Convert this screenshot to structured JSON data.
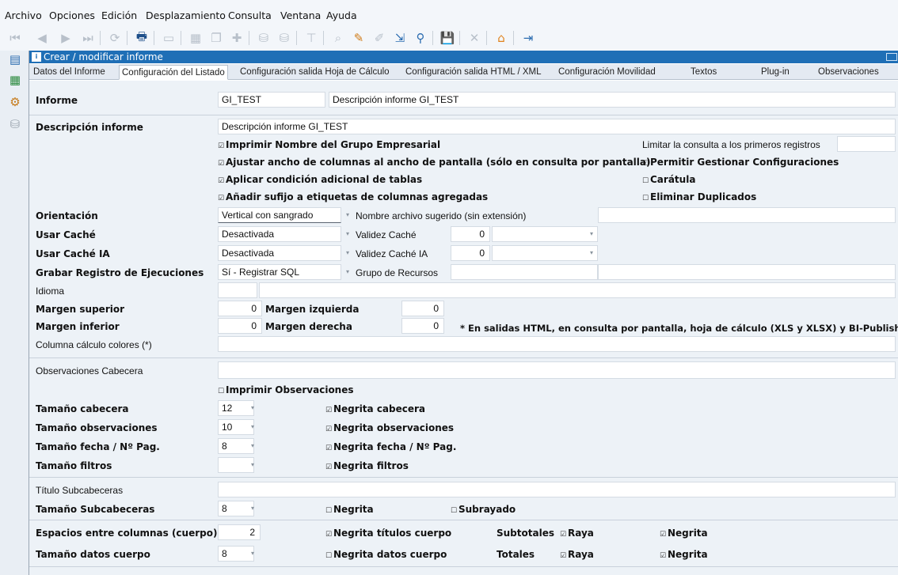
{
  "menu": [
    "Archivo",
    "Opciones",
    "Edición",
    "Desplazamiento",
    "Consulta",
    "Ventana",
    "Ayuda"
  ],
  "window": {
    "title": "Crear / modificar informe"
  },
  "tabs": [
    "Datos del Informe",
    "Configuración del Listado",
    "Configuración salida Hoja de Cálculo",
    "Configuración salida HTML / XML",
    "Configuración Movilidad",
    "Textos",
    "Plug-in",
    "Observaciones"
  ],
  "active_tab": "Configuración del Listado",
  "informe": {
    "label": "Informe",
    "code": "GI_TEST",
    "desc": "Descripción informe GI_TEST"
  },
  "descripcion": {
    "label": "Descripción informe",
    "value": "Descripción informe GI_TEST"
  },
  "checks": {
    "imprimir_nombre": "Imprimir Nombre del Grupo Empresarial",
    "ajustar": "Ajustar ancho de columnas al ancho de pantalla (sólo en consulta por pantalla)",
    "aplicar": "Aplicar condición adicional de tablas",
    "anadir": "Añadir sufijo a etiquetas de columnas agregadas",
    "permitir": "Permitir Gestionar Configuraciones",
    "caratula": "Carátula",
    "eliminar": "Eliminar Duplicados"
  },
  "limitar_label": "Limitar la consulta a los primeros registros",
  "orientacion": {
    "label": "Orientación",
    "value": "Vertical con sangrado",
    "archivo_label": "Nombre archivo sugerido (sin extensión)"
  },
  "cache": {
    "label": "Usar Caché",
    "value": "Desactivada",
    "validez_label": "Validez Caché",
    "validez": "0"
  },
  "cache_ia": {
    "label": "Usar Caché IA",
    "value": "Desactivada",
    "validez_label": "Validez Caché IA",
    "validez": "0"
  },
  "grabar": {
    "label": "Grabar Registro de Ejecuciones",
    "value": "Sí - Registrar SQL",
    "recursos_label": "Grupo de Recursos"
  },
  "idioma_label": "Idioma",
  "margenes": {
    "sup_label": "Margen superior",
    "sup": "0",
    "izq_label": "Margen izquierda",
    "izq": "0",
    "inf_label": "Margen inferior",
    "inf": "0",
    "der_label": "Margen derecha",
    "der": "0",
    "nota": "* En salidas HTML, en consulta por pantalla, hoja de cálculo (XLS y XLSX) y BI-Publisher"
  },
  "colores_label": "Columna cálculo colores (*)",
  "obs_cabecera_label": "Observaciones Cabecera",
  "imprimir_obs": "Imprimir Observaciones",
  "tamanos": {
    "cabecera_label": "Tamaño cabecera",
    "cabecera": "12",
    "negrita_cabecera": "Negrita cabecera",
    "obs_label": "Tamaño observaciones",
    "obs": "10",
    "negrita_obs": "Negrita observaciones",
    "fecha_label": "Tamaño fecha / Nº Pag.",
    "fecha": "8",
    "negrita_fecha": "Negrita fecha / Nº Pag.",
    "filtros_label": "Tamaño filtros",
    "filtros": "",
    "negrita_filtros": "Negrita filtros"
  },
  "subcab": {
    "titulo_label": "Título Subcabeceras",
    "tam_label": "Tamaño Subcabeceras",
    "tam": "8",
    "negrita": "Negrita",
    "subrayado": "Subrayado"
  },
  "cuerpo": {
    "espacios_label": "Espacios entre columnas (cuerpo)",
    "espacios": "2",
    "negrita_titulos": "Negrita títulos cuerpo",
    "subtotales_label": "Subtotales",
    "raya": "Raya",
    "negrita": "Negrita",
    "datos_label": "Tamaño datos cuerpo",
    "datos": "8",
    "negrita_datos": "Negrita datos cuerpo",
    "totales_label": "Totales"
  }
}
